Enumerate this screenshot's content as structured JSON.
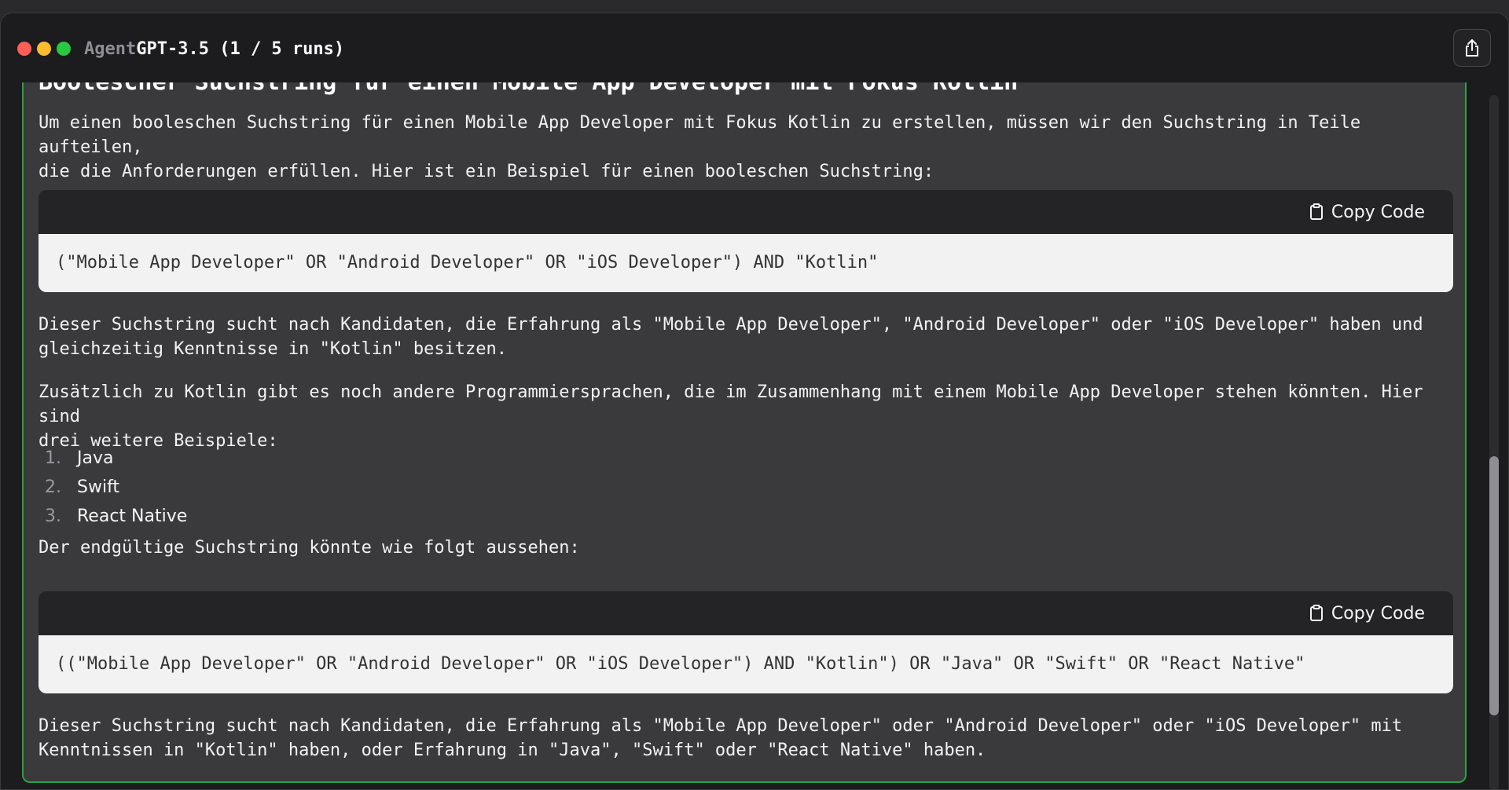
{
  "window": {
    "title_prefix": "Agent",
    "title_model": "GPT-3.5",
    "title_runs": "(1 / 5 runs)"
  },
  "content": {
    "heading": "Boolescher Suchstring für einen Mobile App Developer mit Fokus Kotlin",
    "intro_line1": "Um einen booleschen Suchstring für einen Mobile App Developer mit Fokus Kotlin zu erstellen, müssen wir den Suchstring in Teile aufteilen,",
    "intro_line2": "die die Anforderungen erfüllen. Hier ist ein Beispiel für einen booleschen Suchstring:",
    "code1": "(\"Mobile App Developer\" OR \"Android Developer\" OR \"iOS Developer\") AND \"Kotlin\"",
    "explain1_line1": "Dieser Suchstring sucht nach Kandidaten, die Erfahrung als \"Mobile App Developer\", \"Android Developer\" oder \"iOS Developer\" haben und",
    "explain1_line2": "gleichzeitig Kenntnisse in \"Kotlin\" besitzen.",
    "additional_line1": "Zusätzlich zu Kotlin gibt es noch andere Programmiersprachen, die im Zusammenhang mit einem Mobile App Developer stehen könnten. Hier sind",
    "additional_line2": "drei weitere Beispiele:",
    "list": [
      {
        "num": "1.",
        "text": "Java"
      },
      {
        "num": "2.",
        "text": "Swift"
      },
      {
        "num": "3.",
        "text": "React Native"
      }
    ],
    "final_intro": "Der endgültige Suchstring könnte wie folgt aussehen:",
    "code2": "((\"Mobile App Developer\" OR \"Android Developer\" OR \"iOS Developer\") AND \"Kotlin\") OR \"Java\" OR \"Swift\" OR \"React Native\"",
    "explain2_line1": "Dieser Suchstring sucht nach Kandidaten, die Erfahrung als \"Mobile App Developer\" oder \"Android Developer\" oder \"iOS Developer\" mit",
    "explain2_line2": "Kenntnissen in \"Kotlin\" haben, oder Erfahrung in \"Java\", \"Swift\" oder \"React Native\" haben."
  },
  "code_block": {
    "copy_label": "Copy Code"
  },
  "icons": {
    "share": "share-icon",
    "copy": "clipboard-icon"
  },
  "colors": {
    "accent_border": "#2ea043",
    "close": "#fe5f57",
    "minimize": "#febc2e",
    "maximize": "#28c840"
  }
}
